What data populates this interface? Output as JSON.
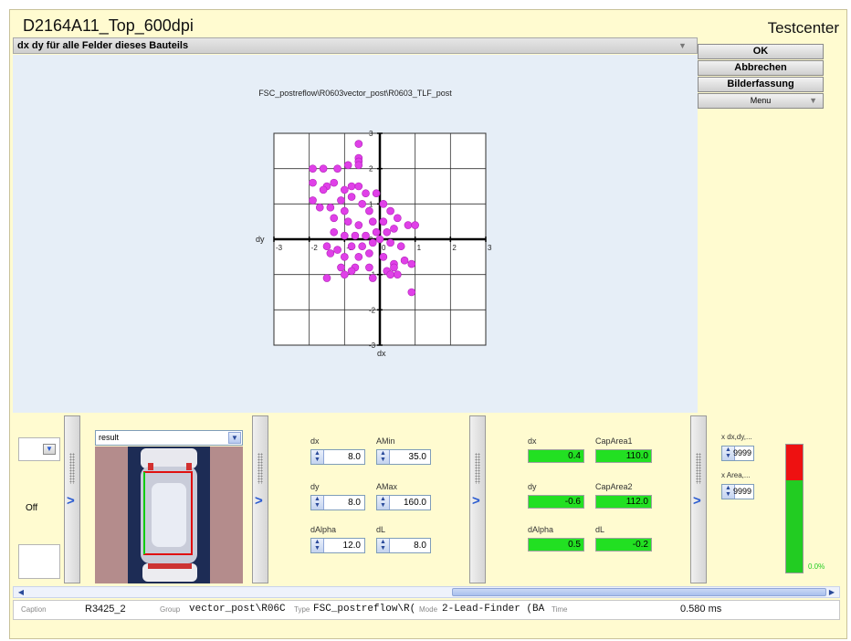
{
  "window": {
    "title": "D2164A11_Top_600dpi",
    "app_name": "Testcenter"
  },
  "panel": {
    "header": "dx dy für alle Felder dieses Bauteils"
  },
  "buttons": {
    "ok": "OK",
    "cancel": "Abbrechen",
    "capture": "Bilderfassung",
    "menu": "Menu"
  },
  "chart_data": {
    "type": "scatter",
    "title": "FSC_postreflow\\R0603vector_post\\R0603_TLF_post",
    "xlabel": "dx",
    "ylabel": "dy",
    "xlim": [
      -3,
      3
    ],
    "ylim": [
      -3,
      3
    ],
    "x_tick_labels": [
      "-3",
      "-2",
      "-1",
      "0",
      "1",
      "2",
      "3"
    ],
    "y_tick_labels": [
      "3",
      "2",
      "1",
      "0",
      "-1",
      "-2",
      "-3"
    ],
    "grid": true,
    "marker_color": "#e040e8",
    "points": [
      [
        -0.6,
        2.7
      ],
      [
        -0.6,
        2.3
      ],
      [
        -0.6,
        2.2
      ],
      [
        -1.2,
        2.0
      ],
      [
        -0.9,
        2.1
      ],
      [
        -0.6,
        2.1
      ],
      [
        -1.9,
        2.0
      ],
      [
        -1.6,
        2.0
      ],
      [
        -1.3,
        1.6
      ],
      [
        -1.9,
        1.6
      ],
      [
        -0.8,
        1.5
      ],
      [
        -1.0,
        1.4
      ],
      [
        -0.6,
        1.5
      ],
      [
        -0.4,
        1.3
      ],
      [
        -0.1,
        1.3
      ],
      [
        -1.5,
        1.5
      ],
      [
        -1.6,
        1.4
      ],
      [
        -1.9,
        1.1
      ],
      [
        -1.1,
        1.1
      ],
      [
        -1.4,
        0.9
      ],
      [
        -0.8,
        1.2
      ],
      [
        -0.5,
        1.0
      ],
      [
        -0.3,
        0.8
      ],
      [
        0.1,
        1.0
      ],
      [
        0.3,
        0.8
      ],
      [
        0.5,
        0.6
      ],
      [
        -1.3,
        0.6
      ],
      [
        -1.7,
        0.9
      ],
      [
        -1.0,
        0.8
      ],
      [
        -0.9,
        0.5
      ],
      [
        -0.6,
        0.4
      ],
      [
        -0.2,
        0.5
      ],
      [
        0.1,
        0.5
      ],
      [
        0.4,
        0.3
      ],
      [
        0.8,
        0.4
      ],
      [
        1.0,
        0.4
      ],
      [
        -1.3,
        0.2
      ],
      [
        -1.0,
        0.1
      ],
      [
        -0.7,
        0.1
      ],
      [
        -0.4,
        0.1
      ],
      [
        -0.1,
        0.2
      ],
      [
        0.2,
        0.2
      ],
      [
        -1.5,
        -0.2
      ],
      [
        -1.2,
        -0.3
      ],
      [
        -0.8,
        -0.2
      ],
      [
        -0.5,
        -0.2
      ],
      [
        -0.2,
        -0.1
      ],
      [
        0.0,
        0.0
      ],
      [
        0.3,
        -0.1
      ],
      [
        0.6,
        -0.2
      ],
      [
        -1.4,
        -0.4
      ],
      [
        -1.0,
        -0.5
      ],
      [
        -0.6,
        -0.5
      ],
      [
        -0.3,
        -0.4
      ],
      [
        0.1,
        -0.5
      ],
      [
        0.4,
        -0.7
      ],
      [
        0.7,
        -0.6
      ],
      [
        -1.1,
        -0.8
      ],
      [
        -0.7,
        -0.8
      ],
      [
        -0.3,
        -0.8
      ],
      [
        0.2,
        -0.9
      ],
      [
        0.5,
        -1.0
      ],
      [
        0.9,
        -0.7
      ],
      [
        -1.5,
        -1.1
      ],
      [
        -1.0,
        -1.0
      ],
      [
        -0.2,
        -1.1
      ],
      [
        0.3,
        -1.0
      ],
      [
        0.9,
        -1.5
      ],
      [
        -0.8,
        -0.9
      ],
      [
        0.4,
        -0.8
      ]
    ]
  },
  "bottom": {
    "left_stub_text": "Off",
    "image_selector": "result",
    "params": {
      "dx_label": "dx",
      "dx_value": "8.0",
      "amin_label": "AMin",
      "amin_value": "35.0",
      "dy_label": "dy",
      "dy_value": "8.0",
      "amax_label": "AMax",
      "amax_value": "160.0",
      "dalpha_label": "dAlpha",
      "dalpha_value": "12.0",
      "dl_label": "dL",
      "dl_value": "8.0"
    },
    "results": {
      "dx_label": "dx",
      "dx_value": "0.4",
      "caparea1_label": "CapArea1",
      "caparea1_value": "110.0",
      "dy_label": "dy",
      "dy_value": "-0.6",
      "caparea2_label": "CapArea2",
      "caparea2_value": "112.0",
      "dalpha_label": "dAlpha",
      "dalpha_value": "0.5",
      "dl_label": "dL",
      "dl_value": "-0.2"
    },
    "limits": {
      "xdxdy_label": "x dx,dy,...",
      "xdxdy_value": "9999",
      "xarea_label": "x Area,...",
      "xarea_value": "9999",
      "bar_percent_text": "0.0%",
      "bar_red_fraction": 0.28
    }
  },
  "statusbar": {
    "caption_label": "Caption",
    "caption_value": "R3425_2",
    "group_label": "Group",
    "group_value": "vector_post\\R06C",
    "type_label": "Type",
    "type_value": "FSC_postreflow\\R(",
    "mode_label": "Mode",
    "mode_value": "2-Lead-Finder (BA",
    "time_label": "Time",
    "time_value": "0.580 ms"
  }
}
